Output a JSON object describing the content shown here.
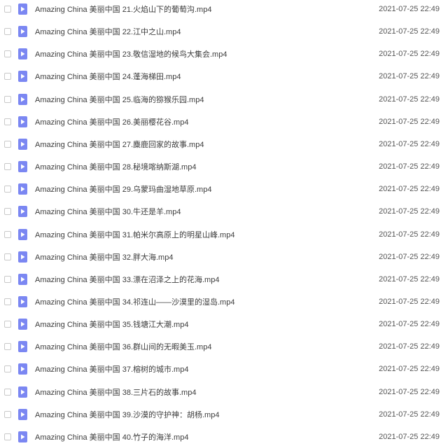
{
  "files": [
    {
      "name": "Amazing China 美丽中国 21.火焰山下的葡萄沟.mp4",
      "date": "2021-07-25 22:49"
    },
    {
      "name": "Amazing China 美丽中国 22.江中之山.mp4",
      "date": "2021-07-25 22:49"
    },
    {
      "name": "Amazing China 美丽中国 23.敬信湿地的候鸟大集会.mp4",
      "date": "2021-07-25 22:49"
    },
    {
      "name": "Amazing China 美丽中国 24.蓬海梯田.mp4",
      "date": "2021-07-25 22:49"
    },
    {
      "name": "Amazing China 美丽中国 25.临海的猕猴乐园.mp4",
      "date": "2021-07-25 22:49"
    },
    {
      "name": "Amazing China 美丽中国 26.美丽樱花谷.mp4",
      "date": "2021-07-25 22:49"
    },
    {
      "name": "Amazing China 美丽中国 27.麋鹿回家的故事.mp4",
      "date": "2021-07-25 22:49"
    },
    {
      "name": "Amazing China 美丽中国 28.秘境喀纳斯湖.mp4",
      "date": "2021-07-25 22:49"
    },
    {
      "name": "Amazing China 美丽中国 29.乌蒙玛曲湿地草原.mp4",
      "date": "2021-07-25 22:49"
    },
    {
      "name": "Amazing China 美丽中国 30.牛还是羊.mp4",
      "date": "2021-07-25 22:49"
    },
    {
      "name": "Amazing China 美丽中国 31.帕米尔高原上的明星山峰.mp4",
      "date": "2021-07-25 22:49"
    },
    {
      "name": "Amazing China 美丽中国 32.胖大海.mp4",
      "date": "2021-07-25 22:49"
    },
    {
      "name": "Amazing China 美丽中国 33.漂在沼泽之上的花海.mp4",
      "date": "2021-07-25 22:49"
    },
    {
      "name": "Amazing China 美丽中国 34.祁连山——沙漠里的湿岛.mp4",
      "date": "2021-07-25 22:49"
    },
    {
      "name": "Amazing China 美丽中国 35.钱塘江大潮.mp4",
      "date": "2021-07-25 22:49"
    },
    {
      "name": "Amazing China 美丽中国 36.群山间的无暇美玉.mp4",
      "date": "2021-07-25 22:49"
    },
    {
      "name": "Amazing China 美丽中国 37.榕树的城市.mp4",
      "date": "2021-07-25 22:49"
    },
    {
      "name": "Amazing China 美丽中国 38.三片石的故事.mp4",
      "date": "2021-07-25 22:49"
    },
    {
      "name": "Amazing China 美丽中国 39.沙漠的守护神：胡杨.mp4",
      "date": "2021-07-25 22:49"
    },
    {
      "name": "Amazing China 美丽中国 40.竹子的海洋.mp4",
      "date": "2021-07-25 22:49"
    }
  ],
  "icon": "video-file-icon",
  "accent_color": "#7b87f2"
}
